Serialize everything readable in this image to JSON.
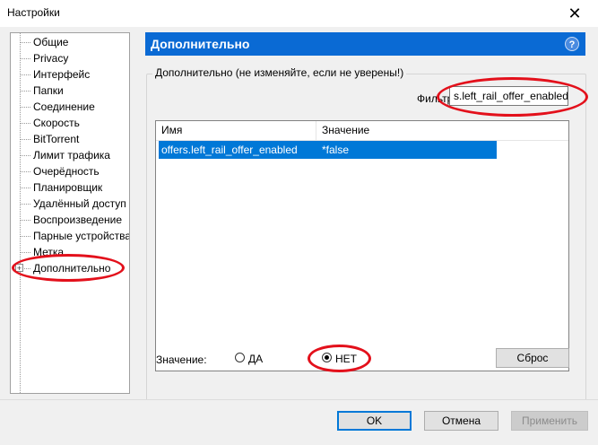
{
  "window": {
    "title": "Настройки",
    "close_glyph": "✕"
  },
  "sidebar": {
    "items": [
      {
        "label": "Общие"
      },
      {
        "label": "Privacy"
      },
      {
        "label": "Интерфейс"
      },
      {
        "label": "Папки"
      },
      {
        "label": "Соединение"
      },
      {
        "label": "Скорость"
      },
      {
        "label": "BitTorrent"
      },
      {
        "label": "Лимит трафика"
      },
      {
        "label": "Очерёдность"
      },
      {
        "label": "Планировщик"
      },
      {
        "label": "Удалённый доступ"
      },
      {
        "label": "Воспроизведение"
      },
      {
        "label": "Парные устройства"
      },
      {
        "label": "Метка"
      },
      {
        "label": "Дополнительно",
        "expander": "+"
      }
    ]
  },
  "panel": {
    "header": "Дополнительно",
    "help_glyph": "?",
    "group_caption": "Дополнительно (не изменяйте, если не уверены!)",
    "filter_label": "Фильтр",
    "filter_value": "s.left_rail_offer_enabled",
    "columns": [
      "Имя",
      "Значение"
    ],
    "rows": [
      {
        "name": "offers.left_rail_offer_enabled",
        "value": "*false"
      }
    ],
    "value_label": "Значение:",
    "radio_yes": "ДА",
    "radio_no": "НЕТ",
    "selected_radio": "no",
    "reset_label": "Сброс"
  },
  "footer": {
    "ok": "OK",
    "cancel": "Отмена",
    "apply": "Применить"
  },
  "colors": {
    "header_bg": "#0a6ad4",
    "selection": "#0078d7",
    "highlight_oval": "#e3101b"
  }
}
